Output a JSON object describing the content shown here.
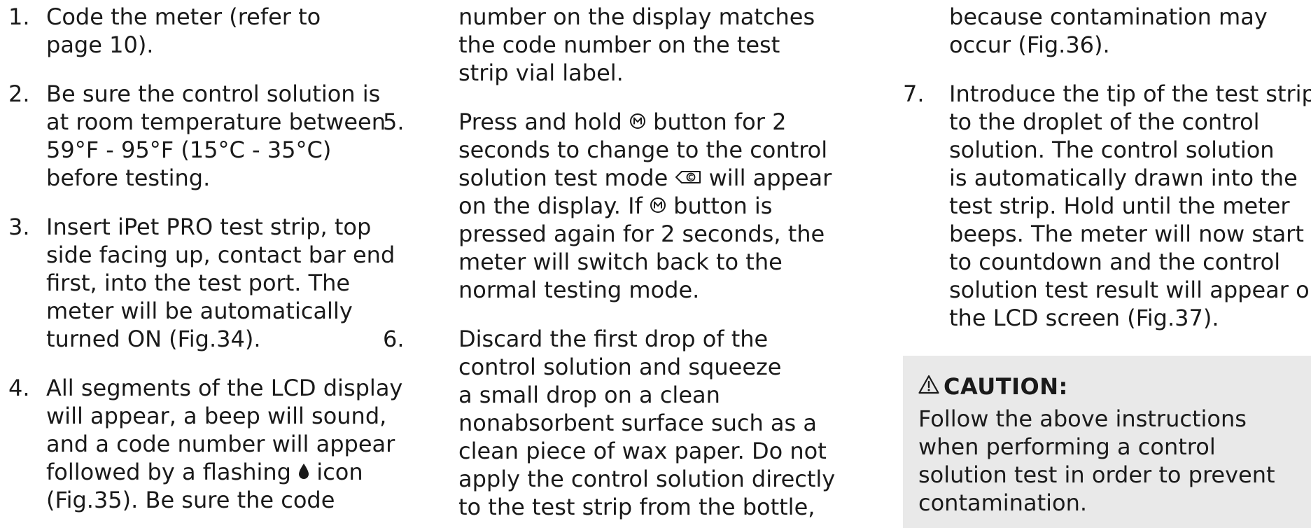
{
  "col1": {
    "items": [
      {
        "num": "1.",
        "lines": [
          "Code the meter (refer to",
          "page 10)."
        ]
      },
      {
        "num": "2.",
        "lines": [
          "Be sure the control solution is",
          "at room temperature between",
          "59°F - 95°F (15°C - 35°C)",
          "before testing."
        ]
      },
      {
        "num": "3.",
        "lines": [
          "Insert iPet PRO test strip, top",
          "side facing up, contact bar end",
          "first, into the test port. The",
          "meter will be automatically",
          "turned ON (Fig.34)."
        ]
      },
      {
        "num": "4.",
        "lines": [
          "All segments of the LCD display",
          "will appear, a beep will sound,",
          "and a code number will appear"
        ],
        "line4_a": "followed by a flashing",
        "line4_b": "icon",
        "lines_after": [
          "(Fig.35). Be sure the code"
        ]
      }
    ]
  },
  "col2": {
    "cont_lines": [
      "number on the display matches",
      "the code number on the test",
      "strip vial label."
    ],
    "item5": {
      "num": "5.",
      "l1_a": "Press and hold",
      "l1_b": "button for 2",
      "l2": "seconds to change to the control",
      "l3_a": "solution test mode",
      "l3_b": "will appear",
      "l4_a": "on the display. If",
      "l4_b": "button is",
      "l5": "pressed again for 2 seconds, the",
      "l6": "meter will switch back to the",
      "l7": "normal testing mode."
    },
    "item6": {
      "num": "6.",
      "lines": [
        "Discard the first drop of the",
        "control solution and squeeze",
        "a small drop on a clean",
        "nonabsorbent surface such as a",
        "clean piece of wax paper. Do not",
        "apply the control solution directly",
        "to the test strip from the bottle,"
      ]
    }
  },
  "col3": {
    "cont_lines": [
      "because contamination may",
      "occur (Fig.36)."
    ],
    "item7": {
      "num": "7.",
      "lines": [
        "Introduce the tip of the test strip",
        "to the droplet of the control",
        "solution. The control solution",
        "is automatically drawn into the",
        "test strip. Hold until the meter",
        "beeps. The meter will now start",
        "to countdown and the control",
        "solution test result will appear on",
        "the LCD screen (Fig.37)."
      ]
    }
  },
  "caution": {
    "heading": "CAUTION:",
    "lines": [
      "Follow the above instructions",
      "when performing a control",
      "solution test in order to prevent",
      "contamination."
    ]
  },
  "icons": {
    "m_button": "m-button-icon",
    "control_mode": "control-solution-mode-icon",
    "drop": "blood-drop-icon",
    "warning": "warning-triangle-icon"
  }
}
